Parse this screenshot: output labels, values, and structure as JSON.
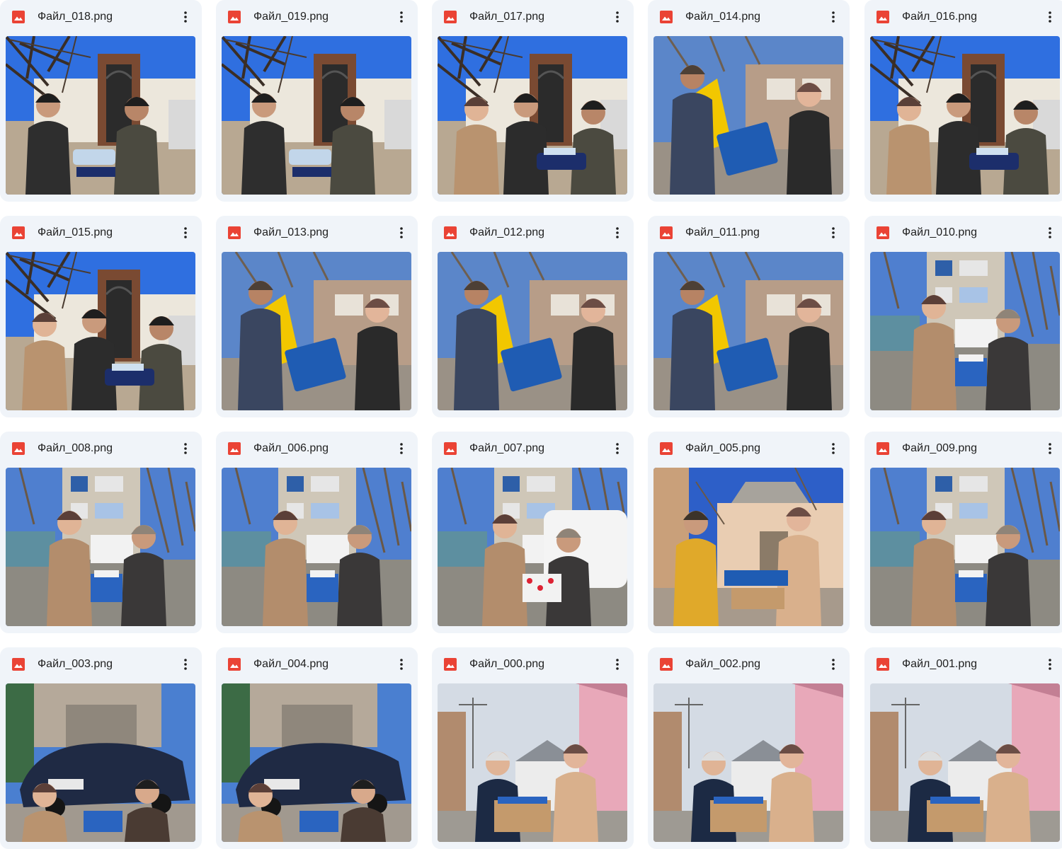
{
  "files": [
    {
      "name": "Файл_018.png",
      "scene": "courtyard-tree",
      "people": "two-men"
    },
    {
      "name": "Файл_019.png",
      "scene": "courtyard-tree",
      "people": "two-men"
    },
    {
      "name": "Файл_017.png",
      "scene": "courtyard-tree",
      "people": "three"
    },
    {
      "name": "Файл_014.png",
      "scene": "excavator",
      "people": "man-woman"
    },
    {
      "name": "Файл_016.png",
      "scene": "courtyard-tree",
      "people": "three"
    },
    {
      "name": "Файл_015.png",
      "scene": "courtyard-tree",
      "people": "three"
    },
    {
      "name": "Файл_013.png",
      "scene": "excavator",
      "people": "man-woman"
    },
    {
      "name": "Файл_012.png",
      "scene": "excavator",
      "people": "man-woman"
    },
    {
      "name": "Файл_011.png",
      "scene": "excavator",
      "people": "man-woman"
    },
    {
      "name": "Файл_010.png",
      "scene": "apartment-yard",
      "people": "two-women"
    },
    {
      "name": "Файл_008.png",
      "scene": "apartment-yard",
      "people": "two-women"
    },
    {
      "name": "Файл_006.png",
      "scene": "apartment-yard",
      "people": "two-women"
    },
    {
      "name": "Файл_007.png",
      "scene": "apartment-yard",
      "people": "two-women-van"
    },
    {
      "name": "Файл_005.png",
      "scene": "house-door",
      "people": "man-woman-yellow"
    },
    {
      "name": "Файл_009.png",
      "scene": "apartment-yard",
      "people": "two-women"
    },
    {
      "name": "Файл_003.png",
      "scene": "car-garage",
      "people": "two-crouching"
    },
    {
      "name": "Файл_004.png",
      "scene": "car-garage",
      "people": "two-crouching"
    },
    {
      "name": "Файл_000.png",
      "scene": "pink-house",
      "people": "two-women-box"
    },
    {
      "name": "Файл_002.png",
      "scene": "pink-house",
      "people": "two-women-box"
    },
    {
      "name": "Файл_001.png",
      "scene": "pink-house",
      "people": "two-women-box"
    }
  ],
  "icons": {
    "file_type": "image-file-icon",
    "menu": "more-vert-icon"
  },
  "colors": {
    "card_background": "#f0f4f9",
    "image_icon_red": "#ea4335",
    "text": "#1f1f1f"
  }
}
